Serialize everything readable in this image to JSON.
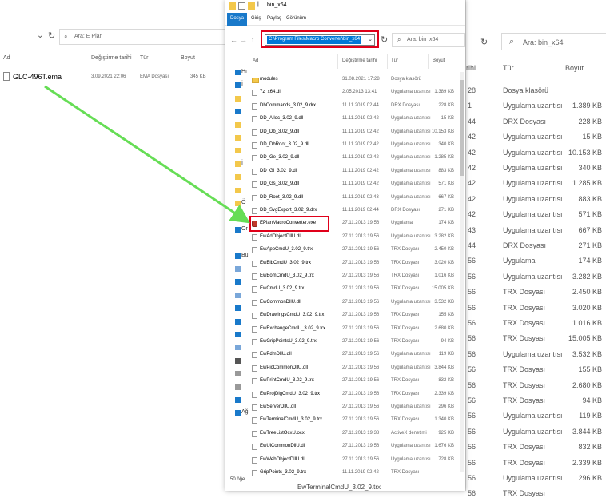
{
  "left_window": {
    "search_placeholder": "Ara: E Plan",
    "columns": [
      "Ad",
      "Değiştirme tarihi",
      "Tür",
      "Boyut"
    ],
    "file": {
      "name": "GLC-496T.ema",
      "date": "3.09.2021 22:06",
      "type": "EMA Dosyası",
      "size": "345 KB"
    }
  },
  "main_window": {
    "title": "bin_x64",
    "ribbon_tabs": [
      "Dosya",
      "Giriş",
      "Paylaş",
      "Görünüm"
    ],
    "address": "C:\\Program Files\\Macro Converter\\bin_x64",
    "search_placeholder": "Ara: bin_x64",
    "columns": [
      "Ad",
      "Değiştirme tarihi",
      "Tür",
      "Boyut"
    ],
    "nav_items": [
      "Hı",
      "İ",
      "",
      "",
      "",
      "",
      "",
      "İ",
      "",
      "",
      "Ö",
      "",
      "Or",
      "",
      "Bu",
      "",
      "",
      "",
      "",
      "",
      "",
      "",
      "",
      "",
      "",
      "",
      "Ağ"
    ],
    "files": [
      {
        "name": "modules",
        "date": "31.08.2021 17:28",
        "type": "Dosya klasörü",
        "size": "",
        "icon": "folder"
      },
      {
        "name": "7z_x64.dll",
        "date": "2.05.2013 13:41",
        "type": "Uygulama uzantısı",
        "size": "1.389 KB",
        "icon": "file"
      },
      {
        "name": "DbCommands_3.02_9.drx",
        "date": "11.11.2019 02:44",
        "type": "DRX Dosyası",
        "size": "228 KB",
        "icon": "file"
      },
      {
        "name": "DD_Alloc_3.02_9.dll",
        "date": "11.11.2019 02:42",
        "type": "Uygulama uzantısı",
        "size": "15 KB",
        "icon": "file"
      },
      {
        "name": "DD_Db_3.02_9.dll",
        "date": "11.11.2019 02:42",
        "type": "Uygulama uzantısı",
        "size": "10.153 KB",
        "icon": "file"
      },
      {
        "name": "DD_DbRoot_3.02_9.dll",
        "date": "11.11.2019 02:42",
        "type": "Uygulama uzantısı",
        "size": "340 KB",
        "icon": "file"
      },
      {
        "name": "DD_Ge_3.02_9.dll",
        "date": "11.11.2019 02:42",
        "type": "Uygulama uzantısı",
        "size": "1.285 KB",
        "icon": "file"
      },
      {
        "name": "DD_Gi_3.02_9.dll",
        "date": "11.11.2019 02:42",
        "type": "Uygulama uzantısı",
        "size": "883 KB",
        "icon": "file"
      },
      {
        "name": "DD_Gs_3.02_9.dll",
        "date": "11.11.2019 02:42",
        "type": "Uygulama uzantısı",
        "size": "571 KB",
        "icon": "file"
      },
      {
        "name": "DD_Root_3.02_9.dll",
        "date": "11.11.2019 02:43",
        "type": "Uygulama uzantısı",
        "size": "667 KB",
        "icon": "file"
      },
      {
        "name": "DD_SvgExport_3.02_9.drx",
        "date": "11.11.2019 02:44",
        "type": "DRX Dosyası",
        "size": "271 KB",
        "icon": "file"
      },
      {
        "name": "EPlanMacroConverter.exe",
        "date": "27.11.2013 19:56",
        "type": "Uygulama",
        "size": "174 KB",
        "icon": "app"
      },
      {
        "name": "EwAdObjectDllU.dll",
        "date": "27.11.2013 19:56",
        "type": "Uygulama uzantısı",
        "size": "3.282 KB",
        "icon": "file"
      },
      {
        "name": "EwAppCmdU_3.02_9.trx",
        "date": "27.11.2013 19:56",
        "type": "TRX Dosyası",
        "size": "2.450 KB",
        "icon": "file"
      },
      {
        "name": "EwBibCmdU_3.02_9.trx",
        "date": "27.11.2013 19:56",
        "type": "TRX Dosyası",
        "size": "3.020 KB",
        "icon": "file"
      },
      {
        "name": "EwBomCmdU_3.02_9.trx",
        "date": "27.11.2013 19:56",
        "type": "TRX Dosyası",
        "size": "1.016 KB",
        "icon": "file"
      },
      {
        "name": "EwCmdU_3.02_9.trx",
        "date": "27.11.2013 19:56",
        "type": "TRX Dosyası",
        "size": "15.005 KB",
        "icon": "file"
      },
      {
        "name": "EwCommonDllU.dll",
        "date": "27.11.2013 19:56",
        "type": "Uygulama uzantısı",
        "size": "3.532 KB",
        "icon": "file"
      },
      {
        "name": "EwDrawingsCmdU_3.02_9.trx",
        "date": "27.11.2013 19:56",
        "type": "TRX Dosyası",
        "size": "155 KB",
        "icon": "file"
      },
      {
        "name": "EwExchangeCmdU_3.02_9.trx",
        "date": "27.11.2013 19:56",
        "type": "TRX Dosyası",
        "size": "2.680 KB",
        "icon": "file"
      },
      {
        "name": "EwGripPointsU_3.02_9.trx",
        "date": "27.11.2013 19:56",
        "type": "TRX Dosyası",
        "size": "94 KB",
        "icon": "file"
      },
      {
        "name": "EwPdmDllU.dll",
        "date": "27.11.2013 19:56",
        "type": "Uygulama uzantısı",
        "size": "119 KB",
        "icon": "file"
      },
      {
        "name": "EwPicCommonDllU.dll",
        "date": "27.11.2013 19:56",
        "type": "Uygulama uzantısı",
        "size": "3.844 KB",
        "icon": "file"
      },
      {
        "name": "EwPrintCmdU_3.02_9.trx",
        "date": "27.11.2013 19:56",
        "type": "TRX Dosyası",
        "size": "832 KB",
        "icon": "file"
      },
      {
        "name": "EwProjDlgCmdU_3.02_9.trx",
        "date": "27.11.2013 19:56",
        "type": "TRX Dosyası",
        "size": "2.339 KB",
        "icon": "file"
      },
      {
        "name": "EwServerDllU.dll",
        "date": "27.11.2013 19:56",
        "type": "Uygulama uzantısı",
        "size": "296 KB",
        "icon": "file"
      },
      {
        "name": "EwTerminalCmdU_3.02_9.trx",
        "date": "27.11.2013 19:56",
        "type": "TRX Dosyası",
        "size": "1.340 KB",
        "icon": "file"
      },
      {
        "name": "EwTreeListOcxU.ocx",
        "date": "27.11.2013 19:38",
        "type": "ActiveX denetimi",
        "size": "925 KB",
        "icon": "file"
      },
      {
        "name": "EwUiCommonDllU.dll",
        "date": "27.11.2013 19:56",
        "type": "Uygulama uzantısı",
        "size": "1.676 KB",
        "icon": "file"
      },
      {
        "name": "EwWebObjectDllU.dll",
        "date": "27.11.2013 19:56",
        "type": "Uygulama uzantısı",
        "size": "728 KB",
        "icon": "file"
      },
      {
        "name": "GripPoints_3.02_9.trx",
        "date": "11.11.2019 02:42",
        "type": "TRX Dosyası",
        "size": "",
        "icon": "file"
      }
    ],
    "status": "50 öğe",
    "peek_text": "EwTerminalCmdU_3.02_9.trx"
  },
  "right_window": {
    "search_placeholder": "Ara: bin_x64",
    "columns": [
      "rihi",
      "Tür",
      "Boyut"
    ],
    "rows": [
      {
        "v": "28",
        "type": "Dosya klasörü",
        "size": ""
      },
      {
        "v": "1",
        "type": "Uygulama uzantısı",
        "size": "1.389 KB"
      },
      {
        "v": "44",
        "type": "DRX Dosyası",
        "size": "228 KB"
      },
      {
        "v": "42",
        "type": "Uygulama uzantısı",
        "size": "15 KB"
      },
      {
        "v": "42",
        "type": "Uygulama uzantısı",
        "size": "10.153 KB"
      },
      {
        "v": "42",
        "type": "Uygulama uzantısı",
        "size": "340 KB"
      },
      {
        "v": "42",
        "type": "Uygulama uzantısı",
        "size": "1.285 KB"
      },
      {
        "v": "42",
        "type": "Uygulama uzantısı",
        "size": "883 KB"
      },
      {
        "v": "42",
        "type": "Uygulama uzantısı",
        "size": "571 KB"
      },
      {
        "v": "43",
        "type": "Uygulama uzantısı",
        "size": "667 KB"
      },
      {
        "v": "44",
        "type": "DRX Dosyası",
        "size": "271 KB"
      },
      {
        "v": "56",
        "type": "Uygulama",
        "size": "174 KB"
      },
      {
        "v": "56",
        "type": "Uygulama uzantısı",
        "size": "3.282 KB"
      },
      {
        "v": "56",
        "type": "TRX Dosyası",
        "size": "2.450 KB"
      },
      {
        "v": "56",
        "type": "TRX Dosyası",
        "size": "3.020 KB"
      },
      {
        "v": "56",
        "type": "TRX Dosyası",
        "size": "1.016 KB"
      },
      {
        "v": "56",
        "type": "TRX Dosyası",
        "size": "15.005 KB"
      },
      {
        "v": "56",
        "type": "Uygulama uzantısı",
        "size": "3.532 KB"
      },
      {
        "v": "56",
        "type": "TRX Dosyası",
        "size": "155 KB"
      },
      {
        "v": "56",
        "type": "TRX Dosyası",
        "size": "2.680 KB"
      },
      {
        "v": "56",
        "type": "TRX Dosyası",
        "size": "94 KB"
      },
      {
        "v": "56",
        "type": "Uygulama uzantısı",
        "size": "119 KB"
      },
      {
        "v": "56",
        "type": "Uygulama uzantısı",
        "size": "3.844 KB"
      },
      {
        "v": "56",
        "type": "TRX Dosyası",
        "size": "832 KB"
      },
      {
        "v": "56",
        "type": "TRX Dosyası",
        "size": "2.339 KB"
      },
      {
        "v": "56",
        "type": "Uygulama uzantısı",
        "size": "296 KB"
      },
      {
        "v": "56",
        "type": "TRX Dosyası",
        "size": ""
      }
    ]
  },
  "colors": {
    "highlight_red": "#e0001a",
    "arrow_green": "#66dd55",
    "selection_blue": "#0078d7",
    "ribbon_active": "#1979ca"
  }
}
